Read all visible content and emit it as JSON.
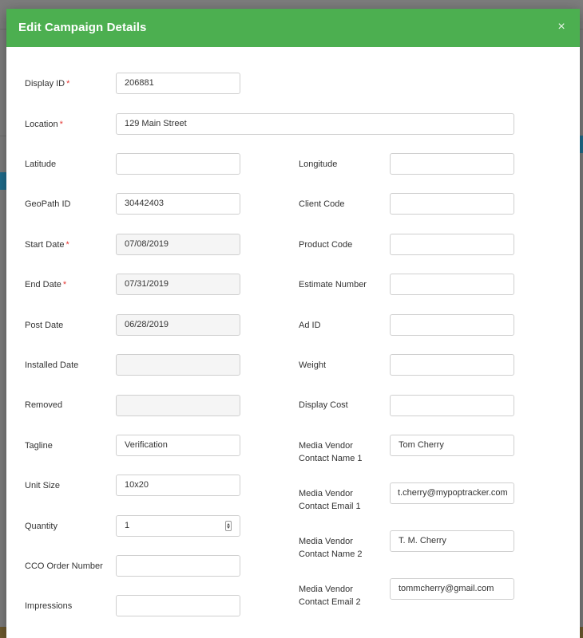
{
  "modal": {
    "title": "Edit Campaign Details",
    "close_icon": "×"
  },
  "required_marker": "*",
  "fields": {
    "display_id": {
      "label": "Display ID",
      "value": "206881"
    },
    "location": {
      "label": "Location",
      "value": "129 Main Street"
    },
    "latitude": {
      "label": "Latitude",
      "value": ""
    },
    "longitude": {
      "label": "Longitude",
      "value": ""
    },
    "geopath_id": {
      "label": "GeoPath ID",
      "value": "30442403"
    },
    "client_code": {
      "label": "Client Code",
      "value": ""
    },
    "start_date": {
      "label": "Start Date",
      "value": "07/08/2019"
    },
    "product_code": {
      "label": "Product Code",
      "value": ""
    },
    "end_date": {
      "label": "End Date",
      "value": "07/31/2019"
    },
    "estimate_number": {
      "label": "Estimate Number",
      "value": ""
    },
    "post_date": {
      "label": "Post Date",
      "value": "06/28/2019"
    },
    "ad_id": {
      "label": "Ad ID",
      "value": ""
    },
    "installed_date": {
      "label": "Installed Date",
      "value": ""
    },
    "weight": {
      "label": "Weight",
      "value": ""
    },
    "removed": {
      "label": "Removed",
      "value": ""
    },
    "display_cost": {
      "label": "Display Cost",
      "value": ""
    },
    "tagline": {
      "label": "Tagline",
      "value": "Verification"
    },
    "vendor_name_1": {
      "label_line1": "Media Vendor",
      "label_line2": "Contact Name 1",
      "value": "Tom Cherry"
    },
    "unit_size": {
      "label": "Unit Size",
      "value": "10x20"
    },
    "vendor_email_1": {
      "label_line1": "Media Vendor",
      "label_line2": "Contact Email 1",
      "value": "t.cherry@mypoptracker.com"
    },
    "quantity": {
      "label": "Quantity",
      "value": "1"
    },
    "vendor_name_2": {
      "label_line1": "Media Vendor",
      "label_line2": "Contact Name 2",
      "value": "T. M. Cherry"
    },
    "cco_order_number": {
      "label": "CCO Order Number",
      "value": ""
    },
    "vendor_email_2": {
      "label_line1": "Media Vendor",
      "label_line2": "Contact Email 2",
      "value": "tommcherry@gmail.com"
    },
    "impressions": {
      "label": "Impressions",
      "value": ""
    }
  },
  "colors": {
    "header_bg": "#4caf50",
    "required": "#e53935"
  }
}
